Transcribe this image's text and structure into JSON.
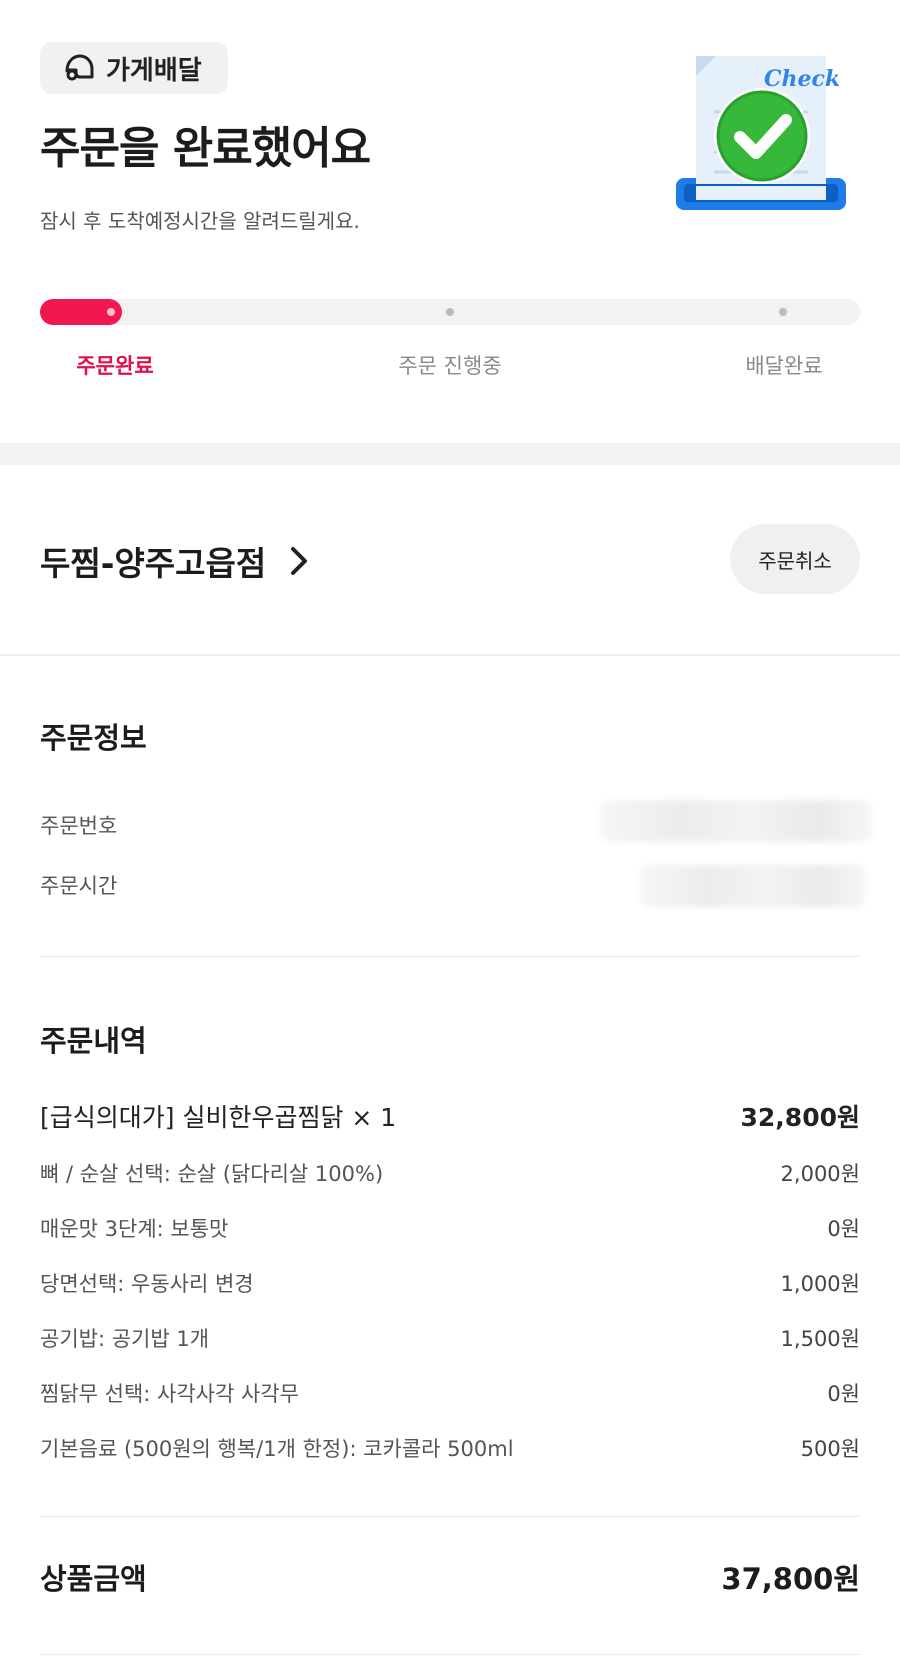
{
  "header": {
    "delivery_type": "가게배달",
    "title": "주문을 완료했어요",
    "subtitle": "잠시 후 도착예정시간을 알려드릴게요.",
    "illustration_text": "Check"
  },
  "progress": {
    "fraction": 0.1,
    "steps": [
      {
        "label": "주문완료",
        "active": true
      },
      {
        "label": "주문 진행중",
        "active": false
      },
      {
        "label": "배달완료",
        "active": false
      }
    ],
    "accent_color": "#f0184f"
  },
  "store": {
    "name": "두찜-양주고읍점",
    "cancel_label": "주문취소"
  },
  "order_info": {
    "title": "주문정보",
    "number_label": "주문번호",
    "time_label": "주문시간"
  },
  "order_detail": {
    "title": "주문내역",
    "main_item": {
      "name": "[급식의대가] 실비한우곱찜닭 × 1",
      "price": "32,800원"
    },
    "options": [
      {
        "name": "뼈 / 순살 선택: 순살 (닭다리살 100%)",
        "price": "2,000원"
      },
      {
        "name": "매운맛 3단계: 보통맛",
        "price": "0원"
      },
      {
        "name": "당면선택: 우동사리 변경",
        "price": "1,000원"
      },
      {
        "name": "공기밥: 공기밥 1개",
        "price": "1,500원"
      },
      {
        "name": "찜닭무 선택: 사각사각 사각무",
        "price": "0원"
      },
      {
        "name": "기본음료 (500원의 행복/1개 한정): 코카콜라 500ml",
        "price": "500원"
      }
    ]
  },
  "total": {
    "label": "상품금액",
    "value": "37,800원"
  }
}
